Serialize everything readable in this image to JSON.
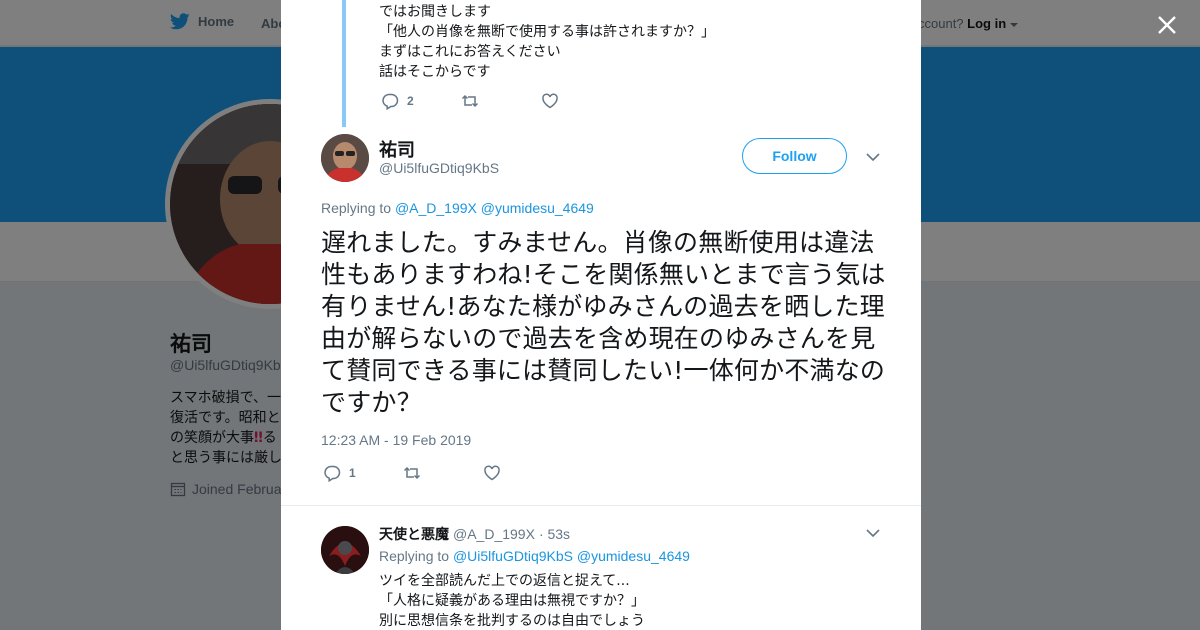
{
  "background": {
    "nav": {
      "home": "Home",
      "about": "Abo",
      "login_prompt": "ccount?",
      "login": "Log in"
    },
    "profile": {
      "name": "祐司",
      "handle": "@Ui5lfuGDtiq9Kb",
      "bio_lines": [
        "スマホ破損で、一",
        "復活です。昭和と",
        "の笑顔が大事",
        "と思う事には厳し"
      ],
      "bio_emoji": "‼",
      "bio_line3_after": "る",
      "joined": "Joined Februa"
    }
  },
  "modal": {
    "previous_tweet": {
      "lines": [
        "ではお聞きします",
        "「他人の肖像を無断で使用する事は許されますか？」",
        "まずはこれにお答えください",
        "話はそこからです"
      ],
      "reply_count": "2"
    },
    "main_tweet": {
      "name": "祐司",
      "handle": "@Ui5lfuGDtiq9KbS",
      "follow_label": "Follow",
      "replying_prefix": "Replying to",
      "replying_to": [
        "@A_D_199X",
        "@yumidesu_4649"
      ],
      "text": "遅れました。すみません。肖像の無断使用は違法性もありますわね!そこを関係無いとまで言う気は有りません!あなた様がゆみさんの過去を晒した理由が解らないので過去を含め現在のゆみさんを見て賛同できる事には賛同したい!一体何か不満なのですか？",
      "timestamp": "12:23 AM - 19 Feb 2019",
      "reply_count": "1"
    },
    "reply_tweet": {
      "name": "天使と悪魔",
      "handle": "@A_D_199X",
      "time": "· 53s",
      "replying_prefix": "Replying to",
      "replying_to": [
        "@Ui5lfuGDtiq9KbS",
        "@yumidesu_4649"
      ],
      "lines": [
        "ツイを全部読んだ上での返信と捉えて...",
        "「人格に疑義がある理由は無視ですか？」",
        "別に思想信条を批判するのは自由でしょう"
      ]
    }
  },
  "colors": {
    "accent": "#1da1f2",
    "link": "#1b95e0",
    "thread_line": "#88c9f9",
    "muted": "#657786"
  },
  "icons": [
    "twitter-bird-icon",
    "close-icon",
    "reply-icon",
    "retweet-icon",
    "like-icon",
    "chevron-down-icon",
    "calendar-icon"
  ]
}
